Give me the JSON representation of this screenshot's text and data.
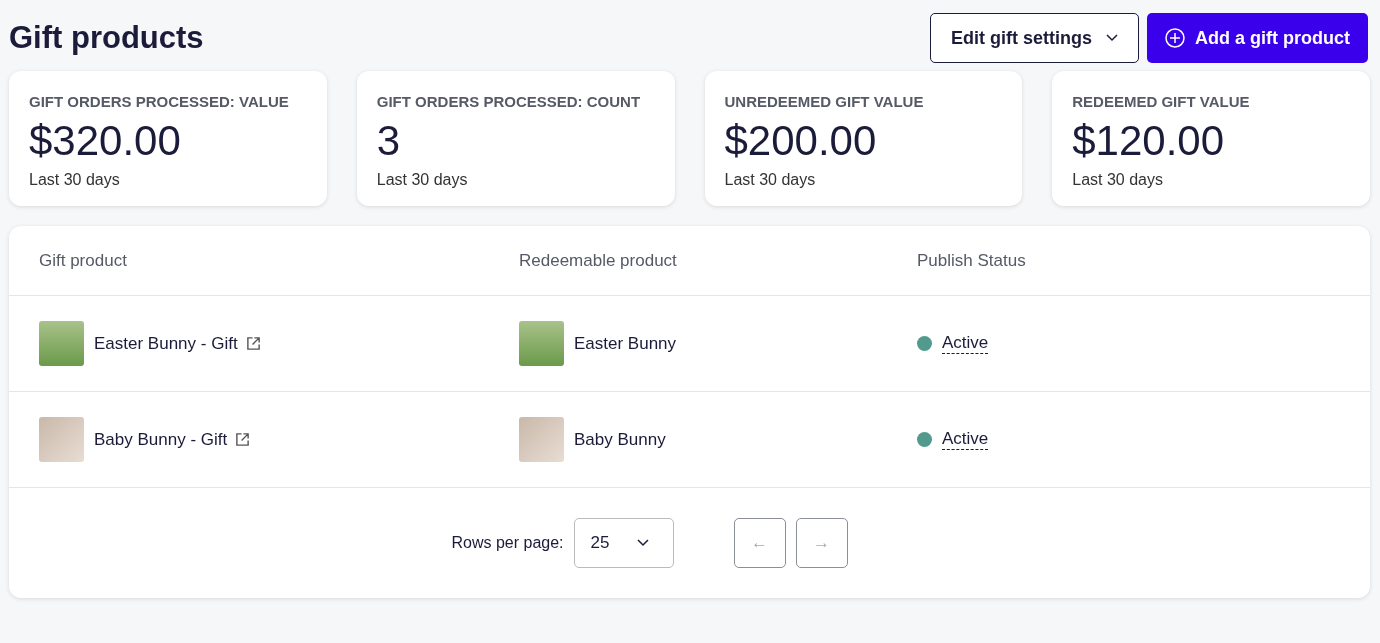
{
  "page": {
    "title": "Gift products"
  },
  "actions": {
    "edit_button": "Edit gift settings",
    "add_button": "Add a gift product"
  },
  "stats": [
    {
      "label": "GIFT ORDERS PROCESSED: VALUE",
      "value": "$320.00",
      "period": "Last 30 days"
    },
    {
      "label": "GIFT ORDERS PROCESSED: COUNT",
      "value": "3",
      "period": "Last 30 days"
    },
    {
      "label": "UNREDEEMED GIFT VALUE",
      "value": "$200.00",
      "period": "Last 30 days"
    },
    {
      "label": "REDEEMED GIFT VALUE",
      "value": "$120.00",
      "period": "Last 30 days"
    }
  ],
  "table": {
    "columns": [
      "Gift product",
      "Redeemable product",
      "Publish Status"
    ],
    "rows": [
      {
        "gift_product": "Easter Bunny - Gift",
        "redeemable_product": "Easter Bunny",
        "status": "Active",
        "color": "#529a8e"
      },
      {
        "gift_product": "Baby Bunny - Gift",
        "redeemable_product": "Baby Bunny",
        "status": "Active",
        "color": "#529a8e"
      }
    ]
  },
  "pagination": {
    "rows_label": "Rows per page:",
    "rows_value": "25",
    "prev": {
      "label": "←",
      "disabled": true
    },
    "next": {
      "label": "→",
      "disabled": true
    }
  }
}
